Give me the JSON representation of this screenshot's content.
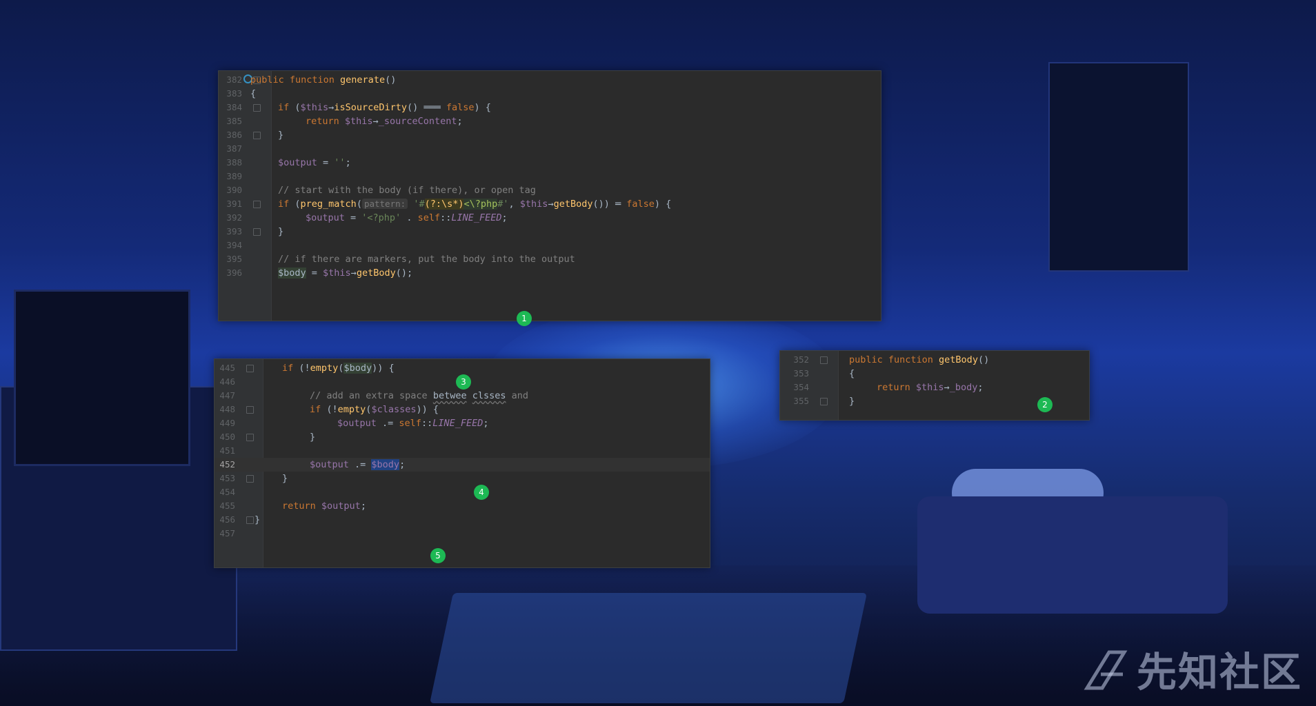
{
  "watermark": {
    "text": "先知社区"
  },
  "panel_top": {
    "lines": [
      {
        "n": "382",
        "parts": [
          [
            "kw",
            "public function "
          ],
          [
            "fn",
            "generate"
          ],
          [
            "op",
            "()"
          ]
        ]
      },
      {
        "n": "383",
        "parts": [
          [
            "op",
            "{"
          ]
        ]
      },
      {
        "n": "384",
        "parts": [
          [
            "kw",
            "if "
          ],
          [
            "op",
            "("
          ],
          [
            "var",
            "$this"
          ],
          [
            "op",
            "→"
          ],
          [
            "fn",
            "isSourceDirty"
          ],
          [
            "op",
            "() ═══ "
          ],
          [
            "kw",
            "false"
          ],
          [
            "op",
            ") {"
          ]
        ]
      },
      {
        "n": "385",
        "parts": [
          [
            "kw",
            "return "
          ],
          [
            "var",
            "$this"
          ],
          [
            "op",
            "→"
          ],
          [
            "var",
            "_sourceContent"
          ],
          [
            "op",
            ";"
          ]
        ]
      },
      {
        "n": "386",
        "parts": [
          [
            "op",
            "}"
          ]
        ]
      },
      {
        "n": "387",
        "parts": []
      },
      {
        "n": "388",
        "parts": [
          [
            "var",
            "$output"
          ],
          [
            "op",
            " = "
          ],
          [
            "str",
            "''"
          ],
          [
            "op",
            ";"
          ]
        ]
      },
      {
        "n": "389",
        "parts": []
      },
      {
        "n": "390",
        "parts": [
          [
            "cm",
            "// start with the body (if there), or open tag"
          ]
        ]
      },
      {
        "n": "391",
        "parts": [
          [
            "kw",
            "if "
          ],
          [
            "op",
            "("
          ],
          [
            "fn",
            "preg_match"
          ],
          [
            "op",
            "("
          ],
          [
            "hint",
            "pattern:"
          ],
          [
            "op",
            " "
          ],
          [
            "str",
            "'#"
          ],
          [
            "rxg",
            "(?:\\s*)"
          ],
          [
            "rx",
            "<\\?php"
          ],
          [
            "str",
            "#'"
          ],
          [
            "op",
            ", "
          ],
          [
            "var",
            "$this"
          ],
          [
            "op",
            "→"
          ],
          [
            "fn",
            "getBody"
          ],
          [
            "op",
            "()) ═ "
          ],
          [
            "kw",
            "false"
          ],
          [
            "op",
            ") {"
          ]
        ]
      },
      {
        "n": "392",
        "parts": [
          [
            "var",
            "$output"
          ],
          [
            "op",
            " = "
          ],
          [
            "str",
            "'<?php'"
          ],
          [
            "op",
            " . "
          ],
          [
            "kw",
            "self"
          ],
          [
            "op",
            "::"
          ],
          [
            "const",
            "LINE_FEED"
          ],
          [
            "op",
            ";"
          ]
        ]
      },
      {
        "n": "393",
        "parts": [
          [
            "op",
            "}"
          ]
        ]
      },
      {
        "n": "394",
        "parts": []
      },
      {
        "n": "395",
        "parts": [
          [
            "cm",
            "// if there are markers, put the body into the output"
          ]
        ]
      },
      {
        "n": "396",
        "parts": [
          [
            "usage",
            "$body"
          ],
          [
            "op",
            " = "
          ],
          [
            "var",
            "$this"
          ],
          [
            "op",
            "→"
          ],
          [
            "fn",
            "getBody"
          ],
          [
            "op",
            "();"
          ]
        ]
      }
    ]
  },
  "panel_left": {
    "lines": [
      {
        "n": "445",
        "parts": [
          [
            "kw",
            "if "
          ],
          [
            "op",
            "(!"
          ],
          [
            "fn",
            "empty"
          ],
          [
            "op",
            "("
          ],
          [
            "usage",
            "$body"
          ],
          [
            "op",
            ")) {"
          ]
        ]
      },
      {
        "n": "446",
        "parts": []
      },
      {
        "n": "447",
        "parts": [
          [
            "cm",
            "// add an extra space "
          ],
          [
            "squig",
            "betwee"
          ],
          [
            "cm",
            " "
          ],
          [
            "squig",
            "clsses"
          ],
          [
            "cm",
            " and"
          ]
        ]
      },
      {
        "n": "448",
        "parts": [
          [
            "kw",
            "if "
          ],
          [
            "op",
            "(!"
          ],
          [
            "fn",
            "empty"
          ],
          [
            "op",
            "("
          ],
          [
            "var",
            "$classes"
          ],
          [
            "op",
            ")) {"
          ]
        ]
      },
      {
        "n": "449",
        "parts": [
          [
            "var",
            "$output"
          ],
          [
            "op",
            " .= "
          ],
          [
            "kw",
            "self"
          ],
          [
            "op",
            "::"
          ],
          [
            "const",
            "LINE_FEED"
          ],
          [
            "op",
            ";"
          ]
        ]
      },
      {
        "n": "450",
        "parts": [
          [
            "op",
            "}"
          ]
        ]
      },
      {
        "n": "451",
        "parts": []
      },
      {
        "n": "452",
        "parts": [
          [
            "var",
            "$output"
          ],
          [
            "op",
            " .= "
          ],
          [
            "sel",
            "$body"
          ],
          [
            "op",
            ";"
          ]
        ]
      },
      {
        "n": "453",
        "parts": [
          [
            "op",
            "}"
          ]
        ]
      },
      {
        "n": "454",
        "parts": []
      },
      {
        "n": "455",
        "parts": [
          [
            "kw",
            "return "
          ],
          [
            "var",
            "$output"
          ],
          [
            "op",
            ";"
          ]
        ]
      },
      {
        "n": "456",
        "parts": [
          [
            "op",
            "}"
          ]
        ]
      },
      {
        "n": "457",
        "parts": []
      }
    ]
  },
  "panel_right": {
    "lines": [
      {
        "n": "352",
        "parts": [
          [
            "kw",
            "public function "
          ],
          [
            "fn",
            "getBody"
          ],
          [
            "op",
            "()"
          ]
        ]
      },
      {
        "n": "353",
        "parts": [
          [
            "op",
            "{"
          ]
        ]
      },
      {
        "n": "354",
        "parts": [
          [
            "kw",
            "return "
          ],
          [
            "var",
            "$this"
          ],
          [
            "op",
            "→"
          ],
          [
            "var",
            "_body"
          ],
          [
            "op",
            ";"
          ]
        ]
      },
      {
        "n": "355",
        "parts": [
          [
            "op",
            "}"
          ]
        ]
      }
    ]
  },
  "badges": [
    "1",
    "2",
    "3",
    "4",
    "5"
  ]
}
